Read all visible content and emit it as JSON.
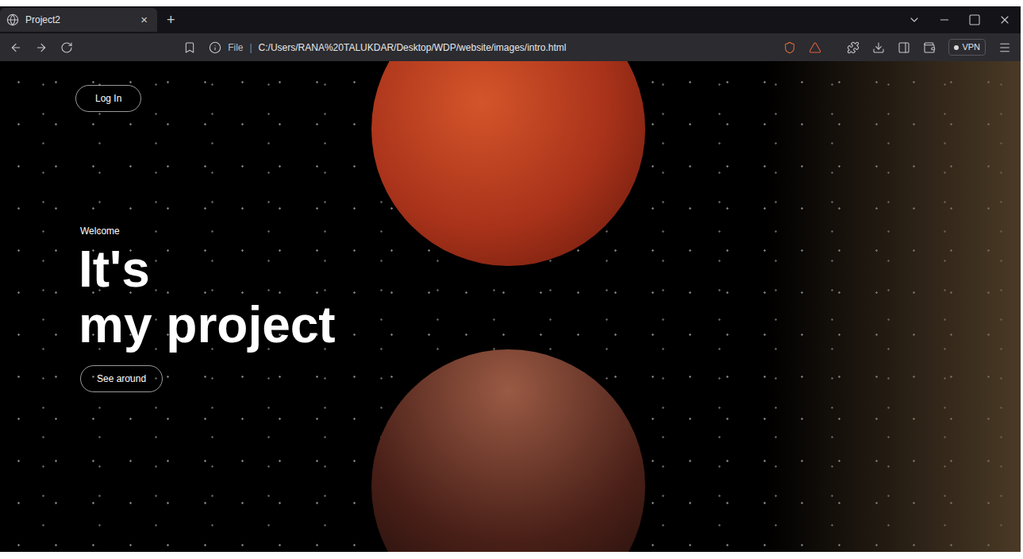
{
  "browser": {
    "tabs": [
      {
        "label": "Project2",
        "selected": true
      }
    ],
    "close_tab": "×",
    "new_tab": "+",
    "address": {
      "scheme": "File",
      "separator": "|",
      "url": "C:/Users/RANA%20TALUKDAR/Desktop/WDP/website/images/intro.html"
    },
    "vpn": "VPN"
  },
  "page": {
    "login_button": "Log In",
    "welcome": "Welcome",
    "headline": [
      "It's",
      "my project"
    ],
    "cta_button": "See around"
  }
}
